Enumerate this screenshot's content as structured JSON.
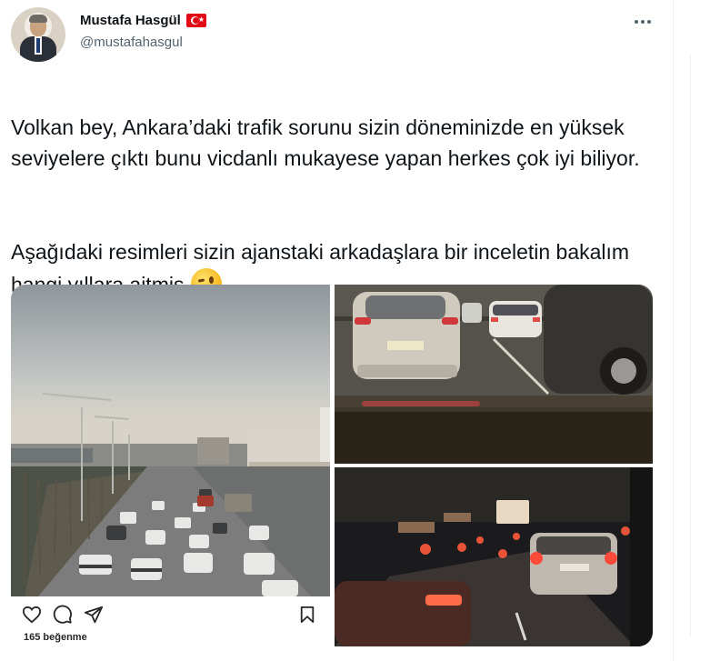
{
  "author": {
    "display_name": "Mustafa Hasgül",
    "handle": "@mustafahasgul",
    "flag": "turkey-flag-icon"
  },
  "tweet": {
    "paragraph_1": "Volkan bey, Ankara’daki trafik sorunu sizin döneminizde en yüksek seviyelere çıktı bunu vicdanlı mukayese yapan  herkes çok iyi biliyor.",
    "paragraph_2": "Aşağıdaki resimleri sizin ajanstaki arkadaşlara bir inceletin bakalım hangi yıllara aitmiş",
    "emoji": "winking-face-icon"
  },
  "media": {
    "instagram_card": {
      "likes_text": "165 beğenme",
      "icons": [
        "heart-icon",
        "comment-icon",
        "share-icon",
        "bookmark-icon"
      ]
    },
    "photos": [
      "highway-traffic-photo",
      "car-rear-traffic-photo",
      "night-traffic-photo"
    ]
  },
  "colors": {
    "text_primary": "#0f1419",
    "text_secondary": "#536471",
    "flag_red": "#e30a17",
    "divider": "#eff3f4"
  }
}
